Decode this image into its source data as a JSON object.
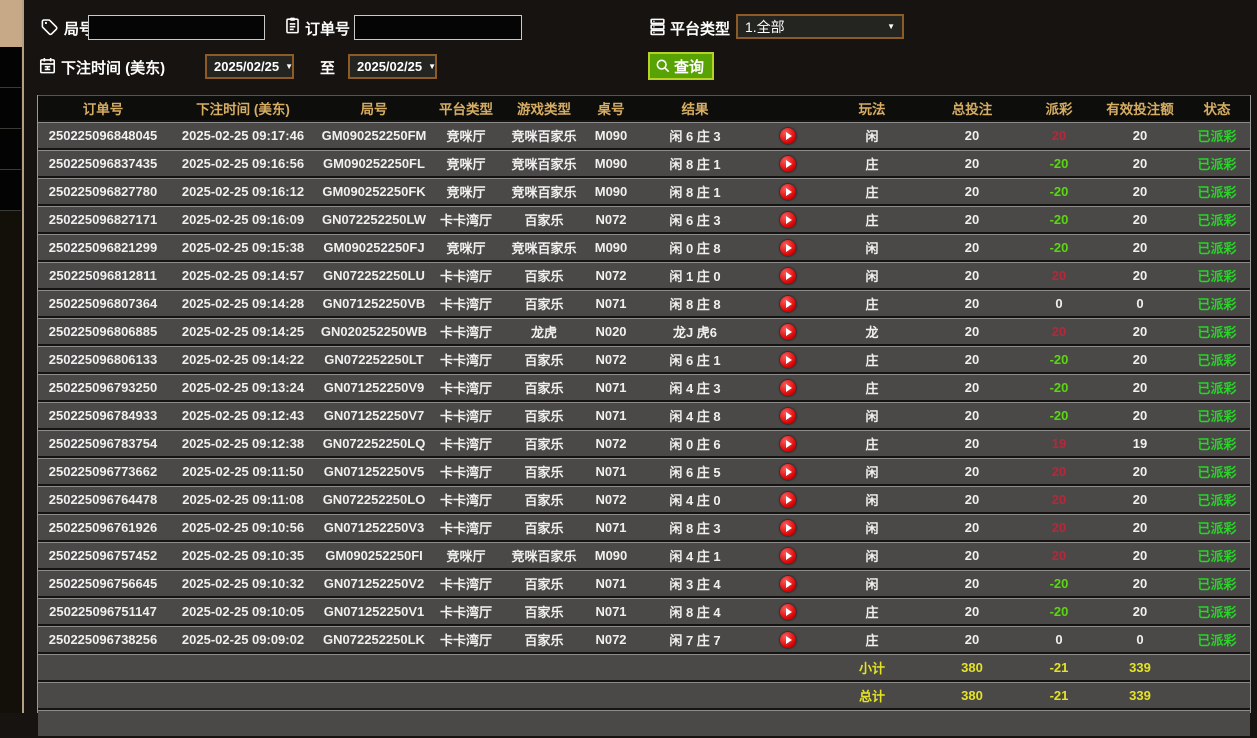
{
  "colors": {
    "accent_gold": "#d6ad62",
    "win_red": "#b5283c",
    "loss_green": "#5bd613",
    "zero_white": "#f0f0f0",
    "status_green": "#27d427",
    "summary_yellow": "#e4e422",
    "button_green": "#58a203",
    "button_border": "#b6d325",
    "picker_border": "#8d5b26",
    "tab_tan": "#c7a988"
  },
  "filters": {
    "round": {
      "label": "局号",
      "value": "",
      "icon": "tag-icon"
    },
    "order": {
      "label": "订单号",
      "value": "",
      "icon": "clipboard-icon"
    },
    "platform": {
      "label": "平台类型",
      "value": "1.全部",
      "icon": "server-icon",
      "chevron": "▼"
    },
    "bet_time": {
      "label": "下注时间 (美东)",
      "icon": "calendar-icon",
      "from": "2025/02/25",
      "to_label": "至",
      "to": "2025/02/25",
      "chevron": "▼"
    },
    "search": {
      "label": "查询",
      "icon": "search-icon"
    }
  },
  "table": {
    "headers": [
      "订单号",
      "下注时间 (美东)",
      "局号",
      "平台类型",
      "游戏类型",
      "桌号",
      "结果",
      "",
      "玩法",
      "总投注",
      "派彩",
      "有效投注额",
      "状态"
    ],
    "rows": [
      {
        "order_id": "250225096848045",
        "bet_time": "2025-02-25 09:17:46",
        "round_id": "GM090252250FM",
        "platform": "竞咪厅",
        "game_type": "竞咪百家乐",
        "table_no": "M090",
        "result": "闲 6 庄 3",
        "bet_type": "闲",
        "total_bet": "20",
        "payout": "20",
        "payout_color": "#b5283c",
        "valid_bet": "20",
        "status": "已派彩"
      },
      {
        "order_id": "250225096837435",
        "bet_time": "2025-02-25 09:16:56",
        "round_id": "GM090252250FL",
        "platform": "竞咪厅",
        "game_type": "竞咪百家乐",
        "table_no": "M090",
        "result": "闲 8 庄 1",
        "bet_type": "庄",
        "total_bet": "20",
        "payout": "-20",
        "payout_color": "#5bd613",
        "valid_bet": "20",
        "status": "已派彩"
      },
      {
        "order_id": "250225096827780",
        "bet_time": "2025-02-25 09:16:12",
        "round_id": "GM090252250FK",
        "platform": "竞咪厅",
        "game_type": "竞咪百家乐",
        "table_no": "M090",
        "result": "闲 8 庄 1",
        "bet_type": "庄",
        "total_bet": "20",
        "payout": "-20",
        "payout_color": "#5bd613",
        "valid_bet": "20",
        "status": "已派彩"
      },
      {
        "order_id": "250225096827171",
        "bet_time": "2025-02-25 09:16:09",
        "round_id": "GN072252250LW",
        "platform": "卡卡湾厅",
        "game_type": "百家乐",
        "table_no": "N072",
        "result": "闲 6 庄 3",
        "bet_type": "庄",
        "total_bet": "20",
        "payout": "-20",
        "payout_color": "#5bd613",
        "valid_bet": "20",
        "status": "已派彩"
      },
      {
        "order_id": "250225096821299",
        "bet_time": "2025-02-25 09:15:38",
        "round_id": "GM090252250FJ",
        "platform": "竞咪厅",
        "game_type": "竞咪百家乐",
        "table_no": "M090",
        "result": "闲 0 庄 8",
        "bet_type": "闲",
        "total_bet": "20",
        "payout": "-20",
        "payout_color": "#5bd613",
        "valid_bet": "20",
        "status": "已派彩"
      },
      {
        "order_id": "250225096812811",
        "bet_time": "2025-02-25 09:14:57",
        "round_id": "GN072252250LU",
        "platform": "卡卡湾厅",
        "game_type": "百家乐",
        "table_no": "N072",
        "result": "闲 1 庄 0",
        "bet_type": "闲",
        "total_bet": "20",
        "payout": "20",
        "payout_color": "#b5283c",
        "valid_bet": "20",
        "status": "已派彩"
      },
      {
        "order_id": "250225096807364",
        "bet_time": "2025-02-25 09:14:28",
        "round_id": "GN071252250VB",
        "platform": "卡卡湾厅",
        "game_type": "百家乐",
        "table_no": "N071",
        "result": "闲 8 庄 8",
        "bet_type": "庄",
        "total_bet": "20",
        "payout": "0",
        "payout_color": "#f0f0f0",
        "valid_bet": "0",
        "status": "已派彩"
      },
      {
        "order_id": "250225096806885",
        "bet_time": "2025-02-25 09:14:25",
        "round_id": "GN020252250WB",
        "platform": "卡卡湾厅",
        "game_type": "龙虎",
        "table_no": "N020",
        "result": "龙J 虎6",
        "bet_type": "龙",
        "total_bet": "20",
        "payout": "20",
        "payout_color": "#b5283c",
        "valid_bet": "20",
        "status": "已派彩"
      },
      {
        "order_id": "250225096806133",
        "bet_time": "2025-02-25 09:14:22",
        "round_id": "GN072252250LT",
        "platform": "卡卡湾厅",
        "game_type": "百家乐",
        "table_no": "N072",
        "result": "闲 6 庄 1",
        "bet_type": "庄",
        "total_bet": "20",
        "payout": "-20",
        "payout_color": "#5bd613",
        "valid_bet": "20",
        "status": "已派彩"
      },
      {
        "order_id": "250225096793250",
        "bet_time": "2025-02-25 09:13:24",
        "round_id": "GN071252250V9",
        "platform": "卡卡湾厅",
        "game_type": "百家乐",
        "table_no": "N071",
        "result": "闲 4 庄 3",
        "bet_type": "庄",
        "total_bet": "20",
        "payout": "-20",
        "payout_color": "#5bd613",
        "valid_bet": "20",
        "status": "已派彩"
      },
      {
        "order_id": "250225096784933",
        "bet_time": "2025-02-25 09:12:43",
        "round_id": "GN071252250V7",
        "platform": "卡卡湾厅",
        "game_type": "百家乐",
        "table_no": "N071",
        "result": "闲 4 庄 8",
        "bet_type": "闲",
        "total_bet": "20",
        "payout": "-20",
        "payout_color": "#5bd613",
        "valid_bet": "20",
        "status": "已派彩"
      },
      {
        "order_id": "250225096783754",
        "bet_time": "2025-02-25 09:12:38",
        "round_id": "GN072252250LQ",
        "platform": "卡卡湾厅",
        "game_type": "百家乐",
        "table_no": "N072",
        "result": "闲 0 庄 6",
        "bet_type": "庄",
        "total_bet": "20",
        "payout": "19",
        "payout_color": "#b5283c",
        "valid_bet": "19",
        "status": "已派彩"
      },
      {
        "order_id": "250225096773662",
        "bet_time": "2025-02-25 09:11:50",
        "round_id": "GN071252250V5",
        "platform": "卡卡湾厅",
        "game_type": "百家乐",
        "table_no": "N071",
        "result": "闲 6 庄 5",
        "bet_type": "闲",
        "total_bet": "20",
        "payout": "20",
        "payout_color": "#b5283c",
        "valid_bet": "20",
        "status": "已派彩"
      },
      {
        "order_id": "250225096764478",
        "bet_time": "2025-02-25 09:11:08",
        "round_id": "GN072252250LO",
        "platform": "卡卡湾厅",
        "game_type": "百家乐",
        "table_no": "N072",
        "result": "闲 4 庄 0",
        "bet_type": "闲",
        "total_bet": "20",
        "payout": "20",
        "payout_color": "#b5283c",
        "valid_bet": "20",
        "status": "已派彩"
      },
      {
        "order_id": "250225096761926",
        "bet_time": "2025-02-25 09:10:56",
        "round_id": "GN071252250V3",
        "platform": "卡卡湾厅",
        "game_type": "百家乐",
        "table_no": "N071",
        "result": "闲 8 庄 3",
        "bet_type": "闲",
        "total_bet": "20",
        "payout": "20",
        "payout_color": "#b5283c",
        "valid_bet": "20",
        "status": "已派彩"
      },
      {
        "order_id": "250225096757452",
        "bet_time": "2025-02-25 09:10:35",
        "round_id": "GM090252250FI",
        "platform": "竞咪厅",
        "game_type": "竞咪百家乐",
        "table_no": "M090",
        "result": "闲 4 庄 1",
        "bet_type": "闲",
        "total_bet": "20",
        "payout": "20",
        "payout_color": "#b5283c",
        "valid_bet": "20",
        "status": "已派彩"
      },
      {
        "order_id": "250225096756645",
        "bet_time": "2025-02-25 09:10:32",
        "round_id": "GN071252250V2",
        "platform": "卡卡湾厅",
        "game_type": "百家乐",
        "table_no": "N071",
        "result": "闲 3 庄 4",
        "bet_type": "闲",
        "total_bet": "20",
        "payout": "-20",
        "payout_color": "#5bd613",
        "valid_bet": "20",
        "status": "已派彩"
      },
      {
        "order_id": "250225096751147",
        "bet_time": "2025-02-25 09:10:05",
        "round_id": "GN071252250V1",
        "platform": "卡卡湾厅",
        "game_type": "百家乐",
        "table_no": "N071",
        "result": "闲 8 庄 4",
        "bet_type": "庄",
        "total_bet": "20",
        "payout": "-20",
        "payout_color": "#5bd613",
        "valid_bet": "20",
        "status": "已派彩"
      },
      {
        "order_id": "250225096738256",
        "bet_time": "2025-02-25 09:09:02",
        "round_id": "GN072252250LK",
        "platform": "卡卡湾厅",
        "game_type": "百家乐",
        "table_no": "N072",
        "result": "闲 7 庄 7",
        "bet_type": "庄",
        "total_bet": "20",
        "payout": "0",
        "payout_color": "#f0f0f0",
        "valid_bet": "0",
        "status": "已派彩"
      }
    ],
    "subtotal": {
      "label": "小计",
      "total_bet": "380",
      "payout": "-21",
      "valid_bet": "339"
    },
    "total": {
      "label": "总计",
      "total_bet": "380",
      "payout": "-21",
      "valid_bet": "339"
    }
  }
}
